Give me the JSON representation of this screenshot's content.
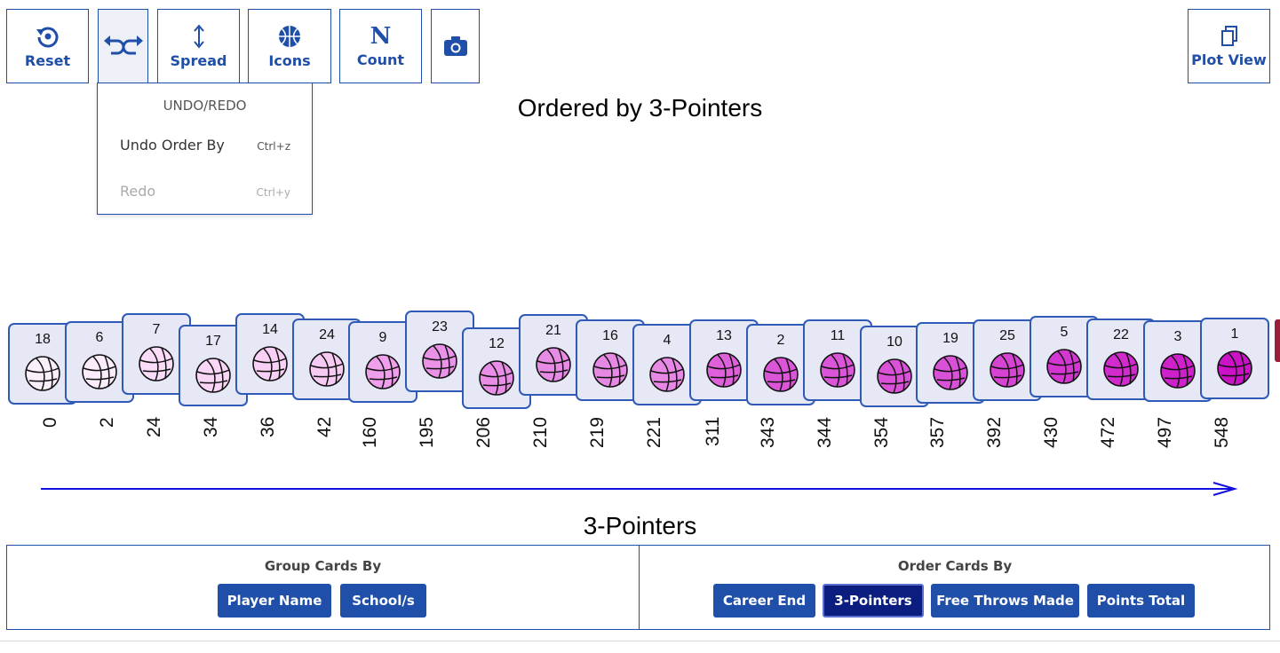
{
  "toolbar": {
    "reset_label": "Reset",
    "spread_label": "Spread",
    "icons_label": "Icons",
    "count_label": "Count",
    "plot_view_label": "Plot View",
    "count_glyph": "N"
  },
  "undo_menu": {
    "header": "UNDO/REDO",
    "undo_label": "Undo Order By",
    "undo_shortcut": "Ctrl+z",
    "redo_label": "Redo",
    "redo_shortcut": "Ctrl+y"
  },
  "plot": {
    "title": "Ordered by 3-Pointers",
    "axis_label": "3-Pointers"
  },
  "cards": [
    {
      "id": "18",
      "value": "0",
      "fill": "#fbeefb"
    },
    {
      "id": "6",
      "value": "2",
      "fill": "#fbecfb"
    },
    {
      "id": "7",
      "value": "24",
      "fill": "#fadcf8"
    },
    {
      "id": "17",
      "value": "34",
      "fill": "#f9d5f6"
    },
    {
      "id": "14",
      "value": "36",
      "fill": "#f8d0f5"
    },
    {
      "id": "24",
      "value": "42",
      "fill": "#f7caf4"
    },
    {
      "id": "9",
      "value": "160",
      "fill": "#ef9fec"
    },
    {
      "id": "23",
      "value": "195",
      "fill": "#ea92e8"
    },
    {
      "id": "12",
      "value": "206",
      "fill": "#e88ee6"
    },
    {
      "id": "21",
      "value": "210",
      "fill": "#e78ce5"
    },
    {
      "id": "16",
      "value": "219",
      "fill": "#e689e4"
    },
    {
      "id": "4",
      "value": "221",
      "fill": "#e688e4"
    },
    {
      "id": "13",
      "value": "311",
      "fill": "#de60da"
    },
    {
      "id": "2",
      "value": "343",
      "fill": "#db55d8"
    },
    {
      "id": "11",
      "value": "344",
      "fill": "#db55d8"
    },
    {
      "id": "10",
      "value": "354",
      "fill": "#da52d7"
    },
    {
      "id": "19",
      "value": "357",
      "fill": "#d951d6"
    },
    {
      "id": "25",
      "value": "392",
      "fill": "#d744d4"
    },
    {
      "id": "5",
      "value": "430",
      "fill": "#d437d1"
    },
    {
      "id": "22",
      "value": "472",
      "fill": "#d12acd"
    },
    {
      "id": "3",
      "value": "497",
      "fill": "#cf21cb"
    },
    {
      "id": "1",
      "value": "548",
      "fill": "#cb12c7"
    }
  ],
  "group_panel": {
    "heading": "Group Cards By",
    "buttons": [
      "Player Name",
      "School/s"
    ]
  },
  "order_panel": {
    "heading": "Order Cards By",
    "buttons": [
      "Career End",
      "3-Pointers",
      "Free Throws Made",
      "Points Total"
    ],
    "selected": "3-Pointers"
  },
  "colors": {
    "accent": "#1f4fa8",
    "selected_button": "#0b1e80",
    "axis_arrow": "#1111dd",
    "card_bg": "#e6e8f5"
  }
}
